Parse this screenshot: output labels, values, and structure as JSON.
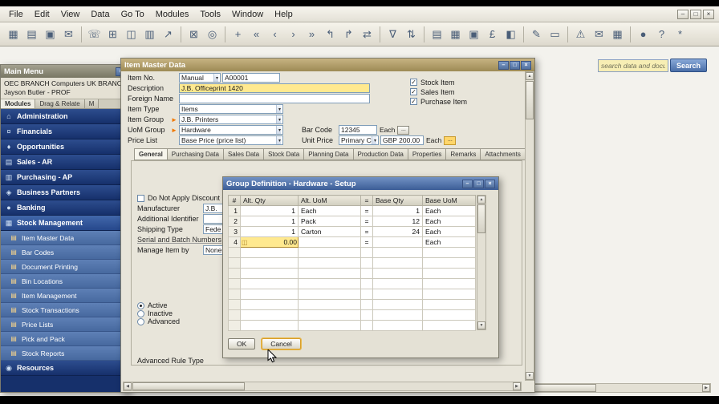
{
  "icons": {
    "dropdown": "▾",
    "link_arrow": "►",
    "browse": "...",
    "check": "✓",
    "up": "▲",
    "down": "▼",
    "left": "◀",
    "right": "▶"
  },
  "chrome": {
    "menu_items": [
      "File",
      "Edit",
      "View",
      "Data",
      "Go To",
      "Modules",
      "Tools",
      "Window",
      "Help"
    ],
    "window_controls": [
      "–",
      "□",
      "×"
    ]
  },
  "toolbar": {
    "groups": [
      [
        {
          "name": "form-settings-icon",
          "glyph": "▦"
        },
        {
          "name": "print-preview-icon",
          "glyph": "▤"
        },
        {
          "name": "print-icon",
          "glyph": "▣"
        },
        {
          "name": "email-icon",
          "glyph": "✉"
        }
      ],
      [
        {
          "name": "fax-icon",
          "glyph": "☏"
        },
        {
          "name": "export-excel-icon",
          "glyph": "⊞"
        },
        {
          "name": "export-word-icon",
          "glyph": "◫"
        },
        {
          "name": "export-pdf-icon",
          "glyph": "▥"
        },
        {
          "name": "launch-application-icon",
          "glyph": "↗"
        }
      ],
      [
        {
          "name": "lock-screen-icon",
          "glyph": "⊠"
        },
        {
          "name": "find-icon",
          "glyph": "◎"
        }
      ],
      [
        {
          "name": "add-record-icon",
          "glyph": "+"
        },
        {
          "name": "first-record-icon",
          "glyph": "«"
        },
        {
          "name": "previous-record-icon",
          "glyph": "‹"
        },
        {
          "name": "next-record-icon",
          "glyph": "›"
        },
        {
          "name": "last-record-icon",
          "glyph": "»"
        },
        {
          "name": "navigate-back-icon",
          "glyph": "↰"
        },
        {
          "name": "navigate-forward-icon",
          "glyph": "↱"
        },
        {
          "name": "refresh-icon",
          "glyph": "⇄"
        }
      ],
      [
        {
          "name": "filter-icon",
          "glyph": "∇"
        },
        {
          "name": "sort-icon",
          "glyph": "⇅"
        }
      ],
      [
        {
          "name": "transaction-journal-icon",
          "glyph": "▤"
        },
        {
          "name": "journal-voucher-icon",
          "glyph": "▦"
        },
        {
          "name": "document-printing-icon",
          "glyph": "▣"
        },
        {
          "name": "payment-wizard-icon",
          "glyph": "£"
        },
        {
          "name": "chart-icon",
          "glyph": "◧"
        }
      ],
      [
        {
          "name": "pencil-edit-icon",
          "glyph": "✎"
        },
        {
          "name": "form-mode-icon",
          "glyph": "▭"
        }
      ],
      [
        {
          "name": "alerts-icon",
          "glyph": "⚠"
        },
        {
          "name": "messages-icon",
          "glyph": "✉"
        },
        {
          "name": "calendar-icon",
          "glyph": "▦"
        }
      ],
      [
        {
          "name": "user-icon",
          "glyph": "●"
        },
        {
          "name": "help-icon",
          "glyph": "?"
        },
        {
          "name": "settings-icon",
          "glyph": "*"
        }
      ]
    ]
  },
  "search": {
    "query_placeholder": "search data and documents",
    "button_label": "Search"
  },
  "main_menu": {
    "title": "Main Menu",
    "company": "OEC BRANCH Computers UK BRANCH",
    "user": "Jayson Butler - PROF",
    "tabs": [
      {
        "label": "Modules",
        "active": true
      },
      {
        "label": "Drag & Relate",
        "active": false
      },
      {
        "label": "M",
        "active": false
      }
    ],
    "items": [
      {
        "label": "Administration",
        "kind": "module",
        "glyph": "⌂"
      },
      {
        "label": "Financials",
        "kind": "module",
        "glyph": "¤"
      },
      {
        "label": "Opportunities",
        "kind": "module",
        "glyph": "♦"
      },
      {
        "label": "Sales - AR",
        "kind": "module",
        "glyph": "▤"
      },
      {
        "label": "Purchasing - AP",
        "kind": "module",
        "glyph": "▥"
      },
      {
        "label": "Business Partners",
        "kind": "module",
        "glyph": "◈"
      },
      {
        "label": "Banking",
        "kind": "module",
        "glyph": "●"
      },
      {
        "label": "Stock Management",
        "kind": "module",
        "glyph": "▦",
        "selected": true
      },
      {
        "label": "Item Master Data",
        "kind": "sub",
        "glyph": "▤"
      },
      {
        "label": "Bar Codes",
        "kind": "sub",
        "glyph": "▤"
      },
      {
        "label": "Document Printing",
        "kind": "sub",
        "glyph": "▤"
      },
      {
        "label": "Bin Locations",
        "kind": "sub",
        "glyph": "▤"
      },
      {
        "label": "Item Management",
        "kind": "sub",
        "glyph": "▤"
      },
      {
        "label": "Stock Transactions",
        "kind": "sub",
        "glyph": "▤"
      },
      {
        "label": "Price Lists",
        "kind": "sub",
        "glyph": "▤"
      },
      {
        "label": "Pick and Pack",
        "kind": "sub",
        "glyph": "▤"
      },
      {
        "label": "Stock Reports",
        "kind": "sub",
        "glyph": "▤"
      },
      {
        "label": "Resources",
        "kind": "module",
        "glyph": "◉"
      }
    ]
  },
  "item_master": {
    "title": "Item Master Data",
    "fields": {
      "item_no": {
        "label": "Item No.",
        "mode": "Manual",
        "value": "A00001"
      },
      "description": {
        "label": "Description",
        "value": "J.B. Officeprint 1420"
      },
      "foreign_name": {
        "label": "Foreign Name",
        "value": ""
      },
      "item_type": {
        "label": "Item Type",
        "value": "Items"
      },
      "item_group": {
        "label": "Item Group",
        "value": "J.B. Printers"
      },
      "uom_group": {
        "label": "UoM Group",
        "value": "Hardware"
      },
      "price_list": {
        "label": "Price List",
        "value": "Base Price (price list)"
      },
      "bar_code": {
        "label": "Bar Code",
        "value": "12345",
        "uom": "Each"
      },
      "unit_price": {
        "label": "Unit Price",
        "currency": "Primary Curr",
        "value": "GBP 200.00",
        "uom": "Each"
      }
    },
    "flags": [
      {
        "label": "Stock Item",
        "checked": true
      },
      {
        "label": "Sales Item",
        "checked": true
      },
      {
        "label": "Purchase Item",
        "checked": true
      }
    ],
    "tabs": [
      {
        "label": "General",
        "active": true
      },
      {
        "label": "Purchasing Data"
      },
      {
        "label": "Sales Data"
      },
      {
        "label": "Stock Data"
      },
      {
        "label": "Planning Data"
      },
      {
        "label": "Production Data"
      },
      {
        "label": "Properties"
      },
      {
        "label": "Remarks"
      },
      {
        "label": "Attachments"
      }
    ],
    "general": {
      "discount_checkbox_label": "Do Not Apply Discount Gro",
      "manufacturer": {
        "label": "Manufacturer",
        "value": "J.B."
      },
      "additional_identifier": {
        "label": "Additional Identifier",
        "value": ""
      },
      "shipping_type": {
        "label": "Shipping Type",
        "value": "Fede"
      },
      "serial_section_label": "Serial and Batch Numbers",
      "manage_item": {
        "label": "Manage Item by",
        "value": "None"
      },
      "status_options": [
        {
          "label": "Active",
          "selected": true
        },
        {
          "label": "Inactive"
        },
        {
          "label": "Advanced"
        }
      ],
      "advanced_rule_label": "Advanced Rule Type"
    }
  },
  "group_definition": {
    "title": "Group Definition - Hardware - Setup",
    "columns": [
      "#",
      "Alt. Qty",
      "Alt. UoM",
      "=",
      "Base Qty",
      "Base UoM"
    ],
    "edit_icon": "◫",
    "rows": [
      {
        "n": "1",
        "alt_qty": "1",
        "alt_uom": "Each",
        "eq": "=",
        "base_qty": "1",
        "base_uom": "Each"
      },
      {
        "n": "2",
        "alt_qty": "1",
        "alt_uom": "Pack",
        "eq": "=",
        "base_qty": "12",
        "base_uom": "Each"
      },
      {
        "n": "3",
        "alt_qty": "1",
        "alt_uom": "Carton",
        "eq": "=",
        "base_qty": "24",
        "base_uom": "Each"
      },
      {
        "n": "4",
        "alt_qty": "0.00",
        "alt_uom": "",
        "eq": "=",
        "base_qty": "",
        "base_uom": "Each",
        "editing": true
      }
    ],
    "empty_row_count": 8,
    "ok_label": "OK",
    "cancel_label": "Cancel"
  },
  "colors": {
    "title_gold": "#b3a069",
    "module_blue": "#1e3a75",
    "submodule_blue": "#5276ad",
    "modal_title_blue": "#44679f",
    "highlight_yellow": "#ffe98f",
    "search_button_blue": "#4a6fa8"
  }
}
